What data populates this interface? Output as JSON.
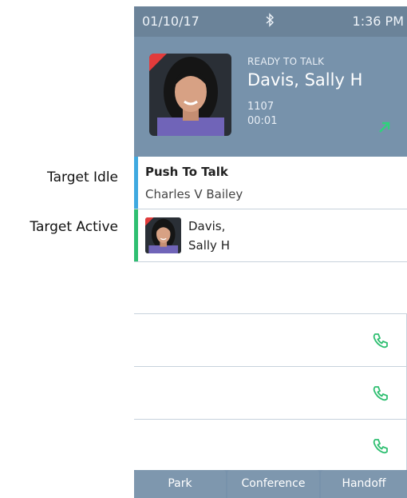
{
  "callouts": {
    "target_idle": "Target Idle",
    "target_active": "Target Active"
  },
  "status_bar": {
    "date": "01/10/17",
    "bluetooth_icon": "bluetooth-icon",
    "time": "1:36 PM"
  },
  "active_call": {
    "status": "READY TO TALK",
    "name": "Davis, Sally H",
    "extension": "1107",
    "duration": "00:01",
    "direction_icon": "outgoing-call-arrow-icon"
  },
  "lines": [
    {
      "title": "Push To Talk",
      "subtitle": "Charles V Bailey",
      "accent_color": "#3fa9e0"
    },
    {
      "name_line1": "Davis,",
      "name_line2": "Sally H",
      "accent_color": "#2fbf71"
    }
  ],
  "line_keys": [
    {
      "icon": "phone-icon"
    },
    {
      "icon": "phone-icon"
    },
    {
      "icon": "phone-icon"
    }
  ],
  "softkeys": [
    "Park",
    "Conference",
    "Handoff"
  ],
  "colors": {
    "header": "#7792ab",
    "status_bar": "#6b8399",
    "accent_green": "#2fbf71",
    "accent_blue": "#3fa9e0"
  }
}
